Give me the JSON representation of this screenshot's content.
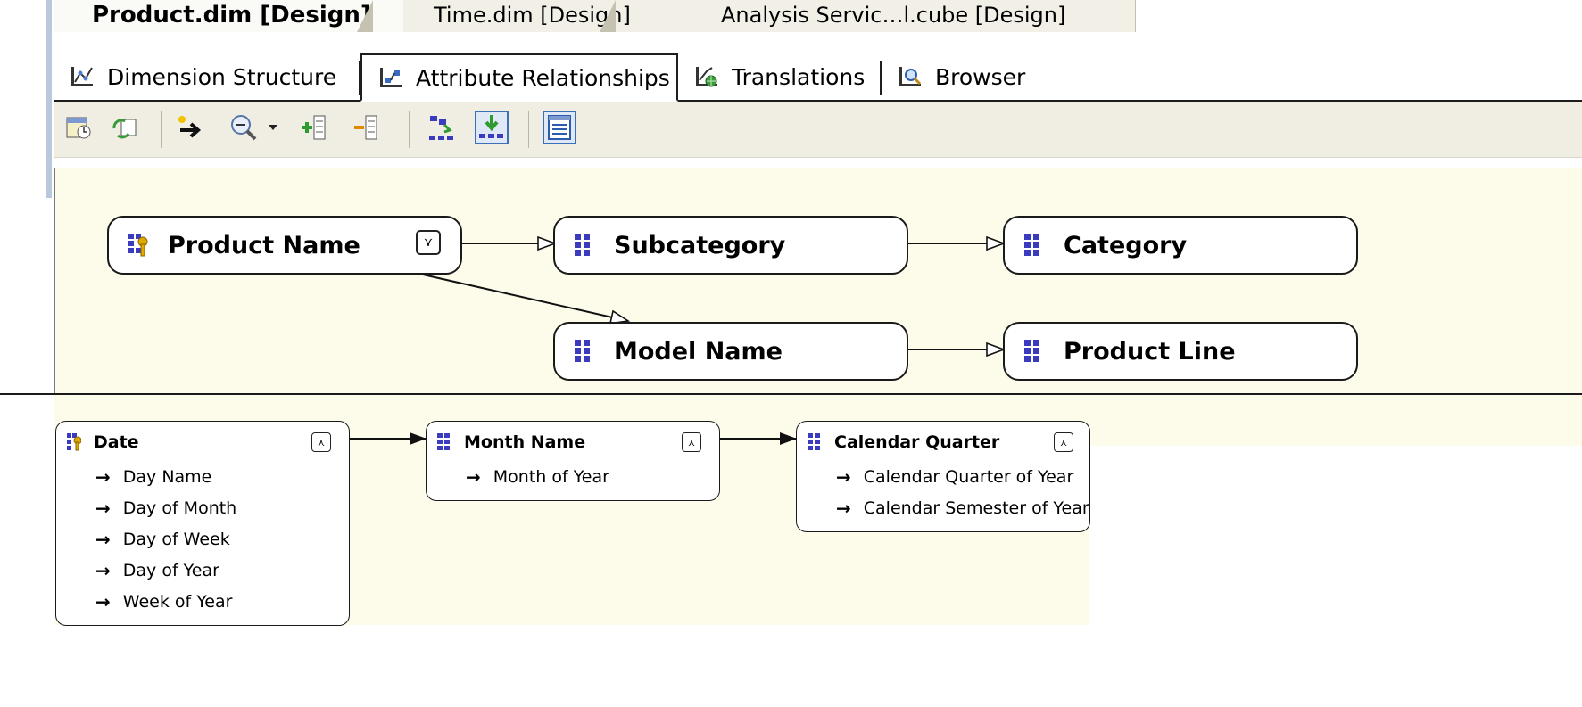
{
  "document_tabs": [
    {
      "label": "Product.dim [Design]",
      "active": true
    },
    {
      "label": "Time.dim [Design]",
      "active": false
    },
    {
      "label": "Analysis Servic…l.cube [Design]",
      "active": false
    }
  ],
  "designer_tabs": [
    {
      "label": "Dimension Structure",
      "icon": "dimension-structure-icon"
    },
    {
      "label": "Attribute Relationships",
      "icon": "attribute-relationships-icon",
      "active": true
    },
    {
      "label": "Translations",
      "icon": "translations-icon"
    },
    {
      "label": "Browser",
      "icon": "browser-icon"
    }
  ],
  "toolbar": {
    "buttons": [
      "process-icon",
      "reconnect-icon",
      "new-relationship-icon",
      "zoom-icon",
      "zoom-dropdown-icon",
      "expand-all-icon",
      "collapse-all-icon",
      "arrange-shapes-icon",
      "show-list-views-icon",
      "show-attribute-list-icon"
    ]
  },
  "product_attributes": {
    "product_name": "Product Name",
    "subcategory": "Subcategory",
    "category": "Category",
    "model_name": "Model Name",
    "product_line": "Product Line"
  },
  "time_attributes": {
    "date": {
      "label": "Date",
      "related": [
        "Day Name",
        "Day of Month",
        "Day of Week",
        "Day of Year",
        "Week of Year"
      ]
    },
    "month_name": {
      "label": "Month Name",
      "related": [
        "Month of Year"
      ]
    },
    "calendar_quarter": {
      "label": "Calendar Quarter",
      "related": [
        "Calendar Quarter of Year",
        "Calendar Semester of Year"
      ]
    }
  },
  "colors": {
    "canvas": "#fdfbea",
    "toolbar": "#f0eee2",
    "grid_icon": "#3b3bbf",
    "key_icon": "#d4a017"
  }
}
